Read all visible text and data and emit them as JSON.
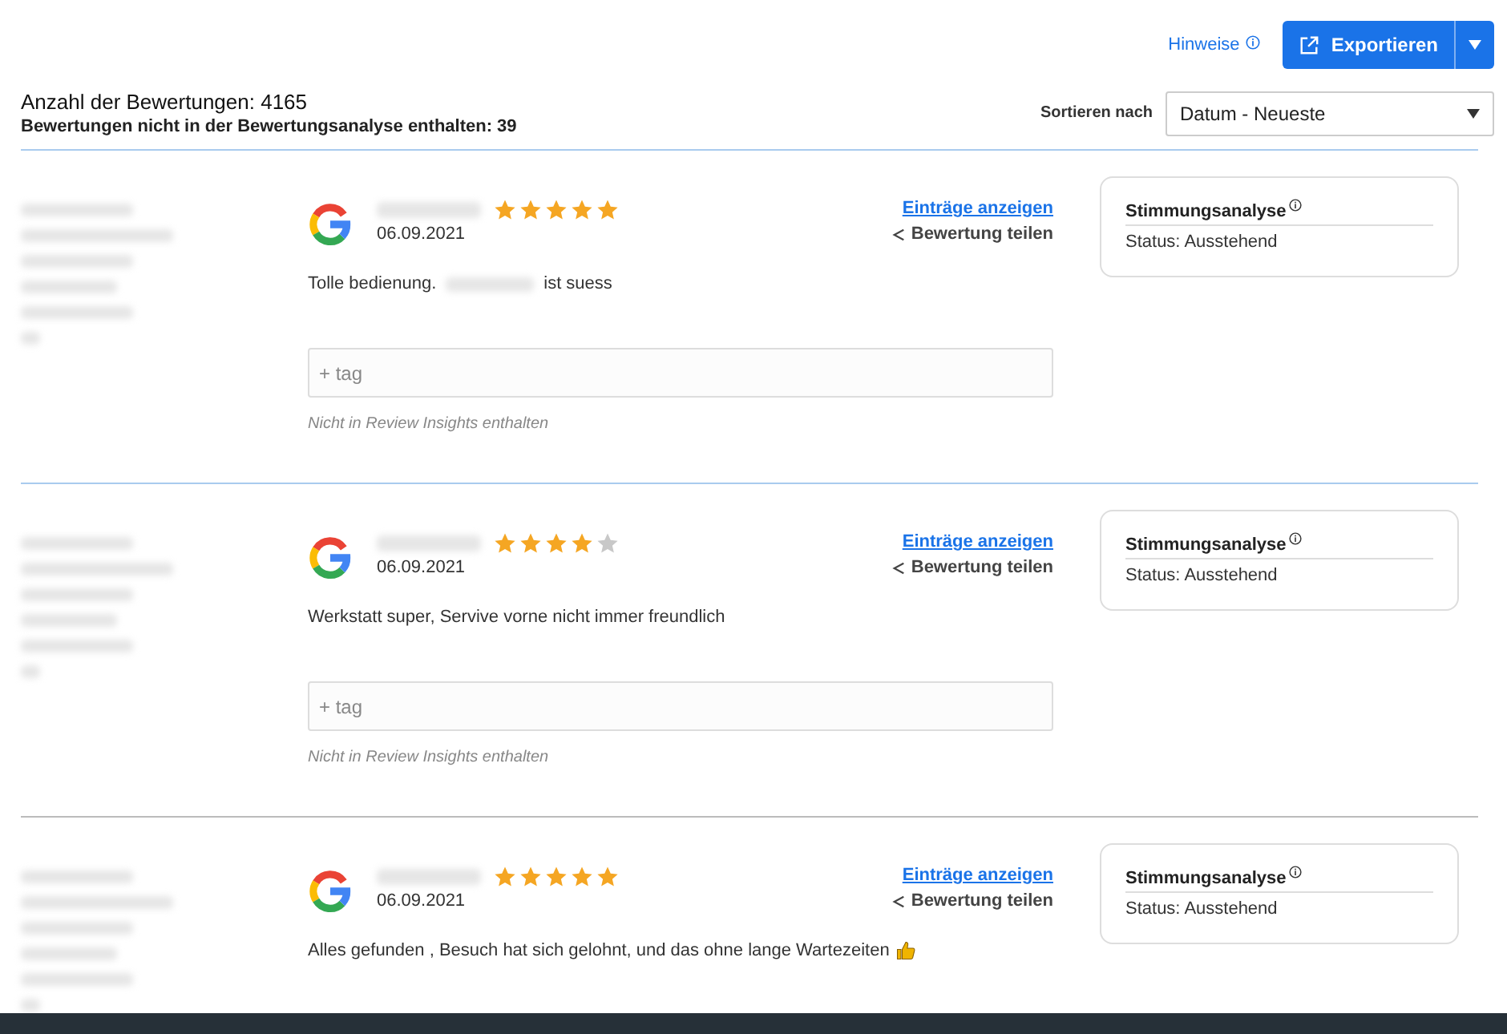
{
  "header": {
    "hint_link": "Hinweise",
    "export_button": "Exportieren",
    "count_line": "Anzahl der Bewertungen: 4165",
    "excluded_line": "Bewertungen nicht in der Bewertungsanalyse enthalten: 39",
    "sort_label": "Sortieren nach",
    "sort_value": "Datum - Neueste"
  },
  "reviews": [
    {
      "stars": 5,
      "date": "06.09.2021",
      "text_before": "Tolle bedienung.",
      "redacted_in_text": true,
      "text_after": "ist suess",
      "thumbs_up": false,
      "entries_link": "Einträge anzeigen",
      "share_link": "Bewertung teilen",
      "tag_placeholder": "+ tag",
      "note": "Nicht in Review Insights enthalten",
      "card_title": "Stimmungsanalyse",
      "card_status": "Status: Ausstehend"
    },
    {
      "stars": 4,
      "date": "06.09.2021",
      "text_before": "Werkstatt super, Servive vorne nicht immer freundlich",
      "redacted_in_text": false,
      "thumbs_up": false,
      "entries_link": "Einträge anzeigen",
      "share_link": "Bewertung teilen",
      "tag_placeholder": "+ tag",
      "note": "Nicht in Review Insights enthalten",
      "card_title": "Stimmungsanalyse",
      "card_status": "Status: Ausstehend"
    },
    {
      "stars": 5,
      "date": "06.09.2021",
      "text_before": "Alles gefunden , Besuch hat sich gelohnt, und das ohne lange Wartezeiten",
      "redacted_in_text": false,
      "thumbs_up": true,
      "entries_link": "Einträge anzeigen",
      "share_link": "Bewertung teilen",
      "card_title": "Stimmungsanalyse",
      "card_status": "Status: Ausstehend"
    }
  ]
}
